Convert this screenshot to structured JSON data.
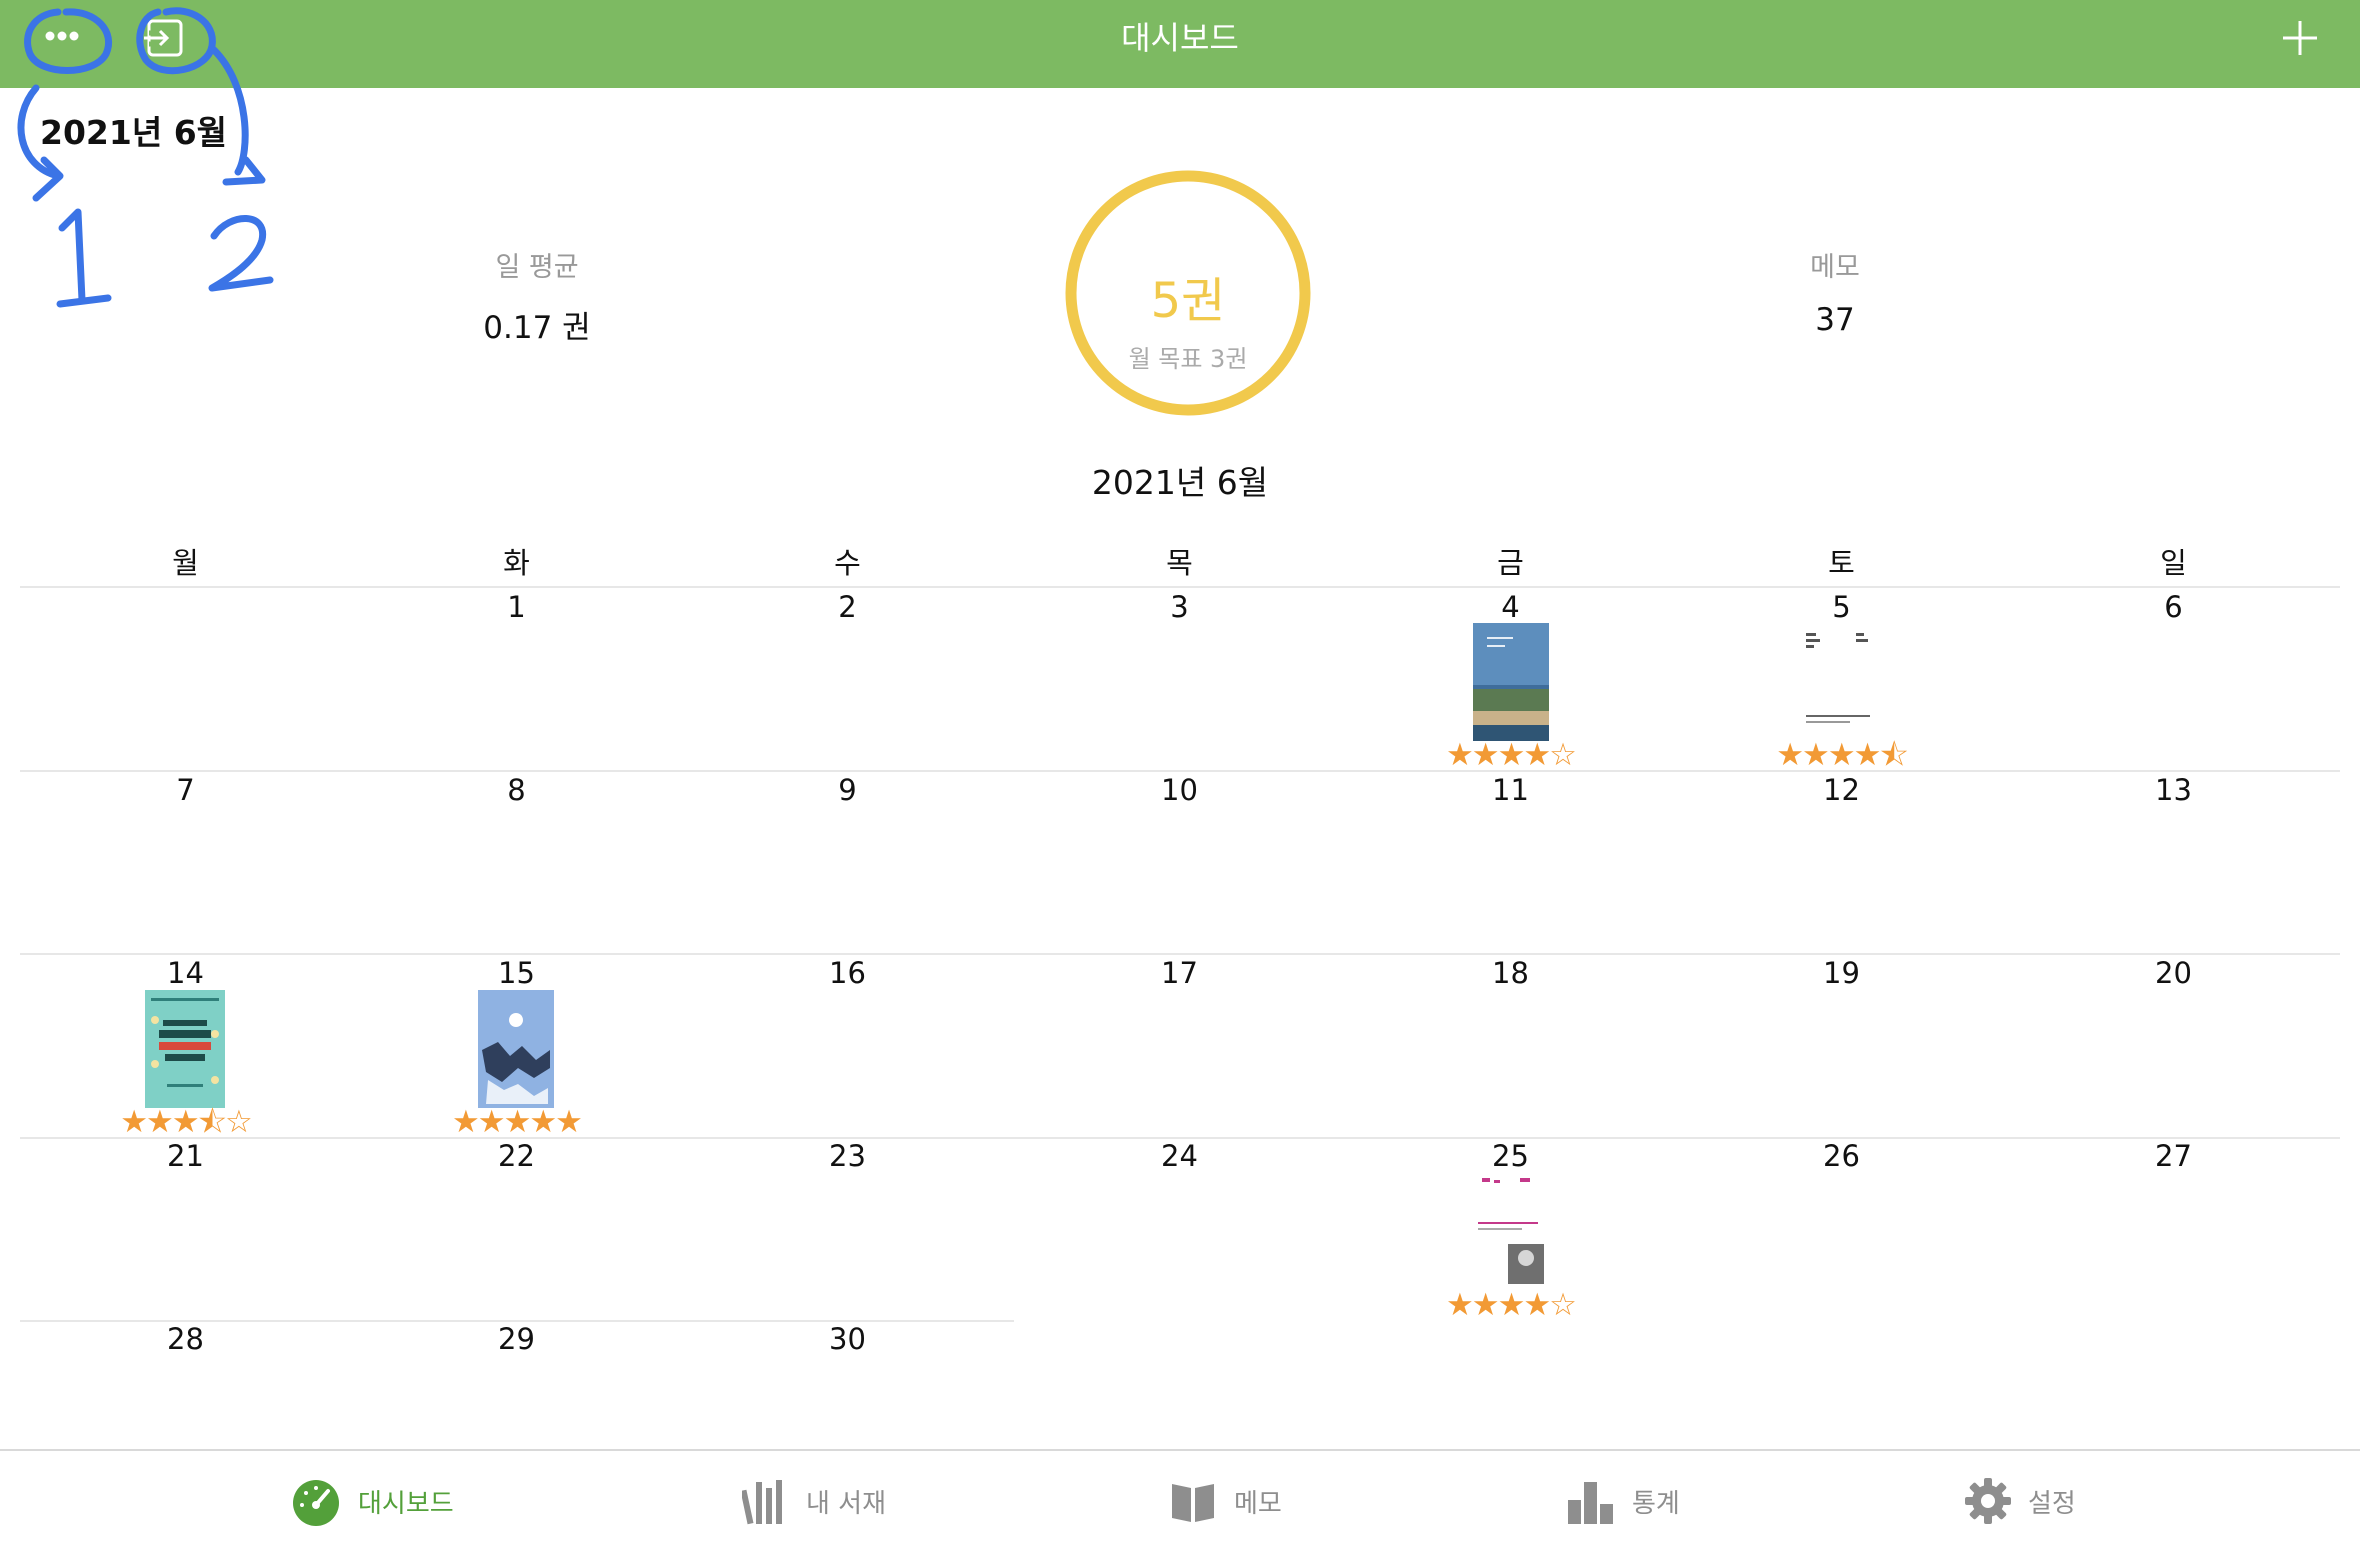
{
  "header": {
    "title": "대시보드"
  },
  "month_label": "2021년 6월",
  "stats": {
    "daily_avg_label": "일 평균",
    "daily_avg_value": "0.17 권",
    "books_count": "5권",
    "monthly_goal": "월 목표 3권",
    "memo_label": "메모",
    "memo_value": "37"
  },
  "calendar": {
    "title": "2021년 6월",
    "weekdays": [
      "월",
      "화",
      "수",
      "목",
      "금",
      "토",
      "일"
    ],
    "days": [
      "1",
      "2",
      "3",
      "4",
      "5",
      "6",
      "7",
      "8",
      "9",
      "10",
      "11",
      "12",
      "13",
      "14",
      "15",
      "16",
      "17",
      "18",
      "19",
      "20",
      "21",
      "22",
      "23",
      "24",
      "25",
      "26",
      "27",
      "28",
      "29",
      "30"
    ],
    "books": [
      {
        "day": "4",
        "rating": 4,
        "stars": "★★★★☆"
      },
      {
        "day": "5",
        "rating": 4.5,
        "stars": "★★★★⯪"
      },
      {
        "day": "14",
        "rating": 3.5,
        "stars": "★★★⯪☆"
      },
      {
        "day": "15",
        "rating": 5,
        "stars": "★★★★★"
      },
      {
        "day": "25",
        "rating": 4,
        "stars": "★★★★☆"
      }
    ]
  },
  "annotations": {
    "one": "1",
    "two": "2"
  },
  "tabs": [
    {
      "label": "대시보드",
      "icon": "speedometer-icon",
      "active": true
    },
    {
      "label": "내 서재",
      "icon": "bookshelf-icon",
      "active": false
    },
    {
      "label": "메모",
      "icon": "open-book-icon",
      "active": false
    },
    {
      "label": "통계",
      "icon": "bar-chart-icon",
      "active": false
    },
    {
      "label": "설정",
      "icon": "gear-icon",
      "active": false
    }
  ],
  "colors": {
    "header_green": "#7dba62",
    "ring_yellow": "#f1c94c",
    "star_orange": "#f29a35",
    "active_tab": "#53a03a",
    "annotation_blue": "#3b74e6"
  }
}
